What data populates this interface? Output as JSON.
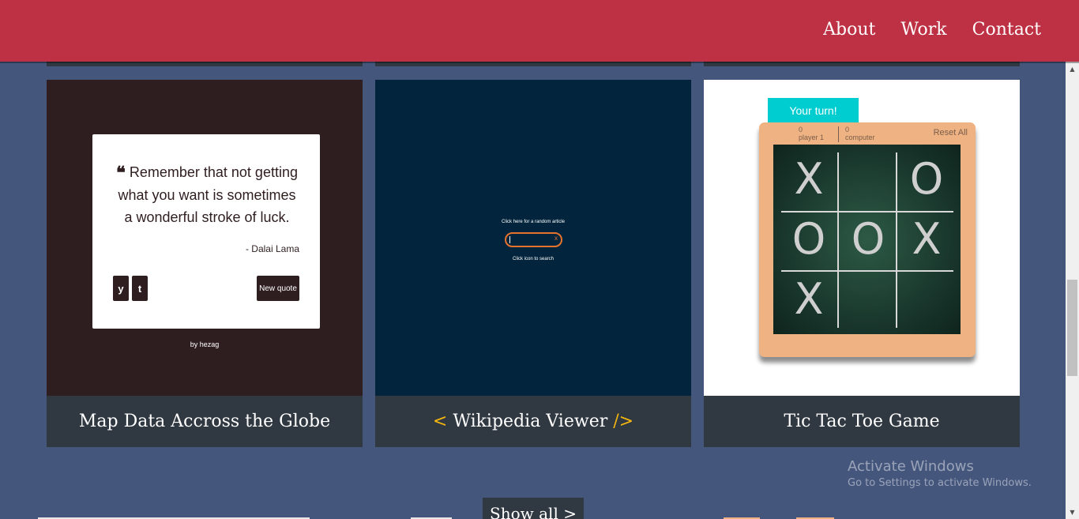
{
  "nav": {
    "links": [
      "About",
      "Work",
      "Contact"
    ]
  },
  "projects": [
    {
      "title": "Map Data Accross the Globe",
      "preview": {
        "quote": "Remember that not getting what you want is sometimes a wonderful stroke of luck.",
        "author": "- Dalai Lama",
        "twitter_glyph": "y",
        "tumblr_glyph": "t",
        "button": "New quote",
        "credit_prefix": "by",
        "credit_name": "hezag"
      }
    },
    {
      "title_open": "<",
      "title": "Wikipedia Viewer",
      "title_close": "/>",
      "preview": {
        "random_link": "Click here for a random article",
        "clear_glyph": "x",
        "hint": "Click icon to search"
      }
    },
    {
      "title": "Tic Tac Toe Game",
      "preview": {
        "turn": "Your turn!",
        "player_score": "0",
        "player_label": "player 1",
        "computer_score": "0",
        "computer_label": "computer",
        "reset": "Reset All",
        "board": [
          "X",
          "",
          "O",
          "O",
          "O",
          "X",
          "X",
          "",
          ""
        ]
      }
    }
  ],
  "show_all": "Show all >",
  "watermark": {
    "title": "Activate Windows",
    "subtitle": "Go to Settings to activate Windows."
  },
  "colors": {
    "navbar": "#be3144",
    "background": "#45567d",
    "card_title_bg": "#303841",
    "bracket": "#f5b70f",
    "turn_badge": "#00cdd0"
  }
}
